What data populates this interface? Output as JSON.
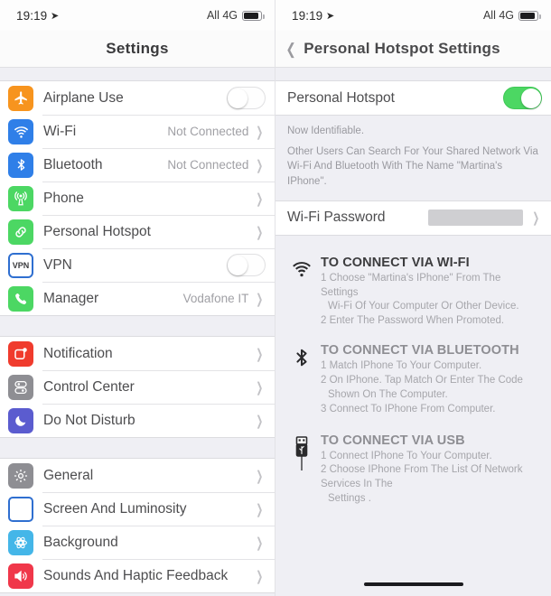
{
  "left": {
    "statusbar": {
      "time": "19:19",
      "location_icon": "location-arrow-icon",
      "network": "All 4G",
      "battery_icon": "battery-icon"
    },
    "nav": {
      "title": "Settings"
    },
    "groups": [
      {
        "rows": [
          {
            "icon": "airplane-icon",
            "label": "Airplane Use",
            "control": "toggle",
            "toggle_on": false
          },
          {
            "icon": "wifi-icon",
            "label": "Wi-Fi",
            "value": "Not Connected",
            "control": "chevron"
          },
          {
            "icon": "bluetooth-icon",
            "label": "Bluetooth",
            "value": "Not Connected",
            "control": "chevron"
          },
          {
            "icon": "cellular-icon",
            "label": "Phone",
            "value": "",
            "control": "chevron"
          },
          {
            "icon": "hotspot-link-icon",
            "label": "Personal Hotspot",
            "value": "",
            "control": "chevron"
          },
          {
            "icon": "vpn-icon",
            "label": "VPN",
            "control": "toggle",
            "toggle_on": false
          },
          {
            "icon": "phone-handset-icon",
            "label": "Manager",
            "value": "Vodafone IT",
            "control": "chevron"
          }
        ]
      },
      {
        "rows": [
          {
            "icon": "notification-icon",
            "label": "Notification",
            "value": "",
            "control": "chevron"
          },
          {
            "icon": "control-center-icon",
            "label": "Control Center",
            "value": "",
            "control": "chevron"
          },
          {
            "icon": "moon-icon",
            "label": "Do Not Disturb",
            "value": "",
            "control": "chevron"
          }
        ]
      },
      {
        "rows": [
          {
            "icon": "gear-icon",
            "label": "General",
            "value": "",
            "control": "chevron"
          },
          {
            "icon": "screen-brightness-icon",
            "label": "Screen And Luminosity",
            "value": "",
            "control": "chevron"
          },
          {
            "icon": "wallpaper-icon",
            "label": "Background",
            "value": "",
            "control": "chevron"
          },
          {
            "icon": "speaker-icon",
            "label": "Sounds And Haptic Feedback",
            "value": "",
            "control": "chevron"
          }
        ]
      }
    ]
  },
  "right": {
    "statusbar": {
      "time": "19:19",
      "location_icon": "location-arrow-icon",
      "network": "All 4G",
      "battery_icon": "battery-icon"
    },
    "nav": {
      "back_icon": "back-chevron-icon",
      "title": "Personal Hotspot Settings"
    },
    "hotspot_row": {
      "label": "Personal Hotspot",
      "toggle_on": true
    },
    "footer": {
      "line1": "Now Identifiable.",
      "line2": "Other Users Can Search For Your Shared Network Via Wi-Fi And Bluetooth With The Name \"Martina's IPhone\"."
    },
    "password_row": {
      "label": "Wi-Fi Password",
      "value": "",
      "value_redacted": true
    },
    "instructions": [
      {
        "icon": "wifi-icon",
        "title": "TO CONNECT VIA WI-FI",
        "steps": [
          "1 Choose \"Martina's IPhone\" From The Settings",
          "Wi-Fi Of Your Computer Or Other Device.",
          "2 Enter The Password When Promoted."
        ],
        "indent": [
          false,
          true,
          false
        ]
      },
      {
        "icon": "bluetooth-icon",
        "title": "TO CONNECT VIA BLUETOOTH",
        "steps": [
          "1 Match IPhone To Your Computer.",
          "2 On IPhone. Tap Match Or Enter The Code",
          "Shown On The Computer.",
          "3 Connect To IPhone From Computer."
        ],
        "indent": [
          false,
          false,
          true,
          false
        ]
      },
      {
        "icon": "usb-icon",
        "title": "TO CONNECT VIA USB",
        "steps": [
          "1 Connect IPhone To Your Computer.",
          "2 Choose IPhone From The List Of Network Services In The",
          "Settings ."
        ],
        "indent": [
          false,
          false,
          true
        ]
      }
    ],
    "home_indicator": "home-indicator"
  },
  "colors": {
    "airplane": "#f7941e",
    "wifi": "#2f7fe8",
    "bluetooth": "#2f7fe8",
    "cellular": "#4cd763",
    "hotspot": "#4cd763",
    "vpn_border": "#2f6fd0",
    "manager": "#4cd763",
    "notification": "#f03b2d",
    "control_center": "#8e8e93",
    "dnd": "#5b5ccf",
    "general": "#8e8e93",
    "screen": "#2f6fd0",
    "background_icon": "#44b6e8",
    "sounds": "#f0374a",
    "toggle_on": "#4cd763",
    "group_bg": "#ffffff",
    "page_bg": "#efeff4"
  }
}
